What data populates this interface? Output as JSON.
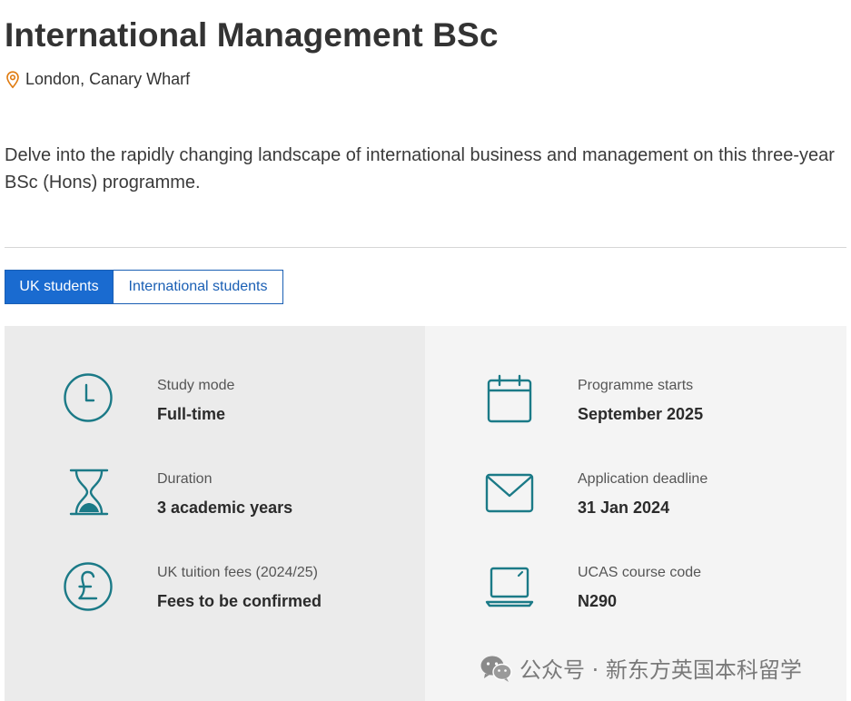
{
  "course": {
    "title": "International Management BSc",
    "location": "London, Canary Wharf",
    "intro": "Delve into the rapidly changing landscape of international business and management on this three-year BSc (Hons) programme."
  },
  "tabs": [
    {
      "label": "UK students",
      "active": true
    },
    {
      "label": "International students",
      "active": false
    }
  ],
  "details": {
    "study_mode": {
      "label": "Study mode",
      "value": "Full-time",
      "icon": "clock-icon"
    },
    "duration": {
      "label": "Duration",
      "value": "3 academic years",
      "icon": "hourglass-icon"
    },
    "fees": {
      "label": "UK tuition fees (2024/25)",
      "value": "Fees to be confirmed",
      "icon": "pound-icon"
    },
    "start": {
      "label": "Programme starts",
      "value": "September 2025",
      "icon": "calendar-icon"
    },
    "deadline": {
      "label": "Application deadline",
      "value": "31 Jan 2024",
      "icon": "envelope-icon"
    },
    "ucas": {
      "label": "UCAS course code",
      "value": "N290",
      "icon": "laptop-icon"
    }
  },
  "watermark": {
    "text": "公众号 · 新东方英国本科留学",
    "icon": "wechat-icon"
  },
  "colors": {
    "icon_teal": "#1b7a87",
    "pin_orange": "#e07b10",
    "tab_active": "#1a6bd0",
    "tab_border": "#1a5fb4",
    "panel_left": "#ebebeb",
    "panel_right": "#f4f4f4"
  }
}
